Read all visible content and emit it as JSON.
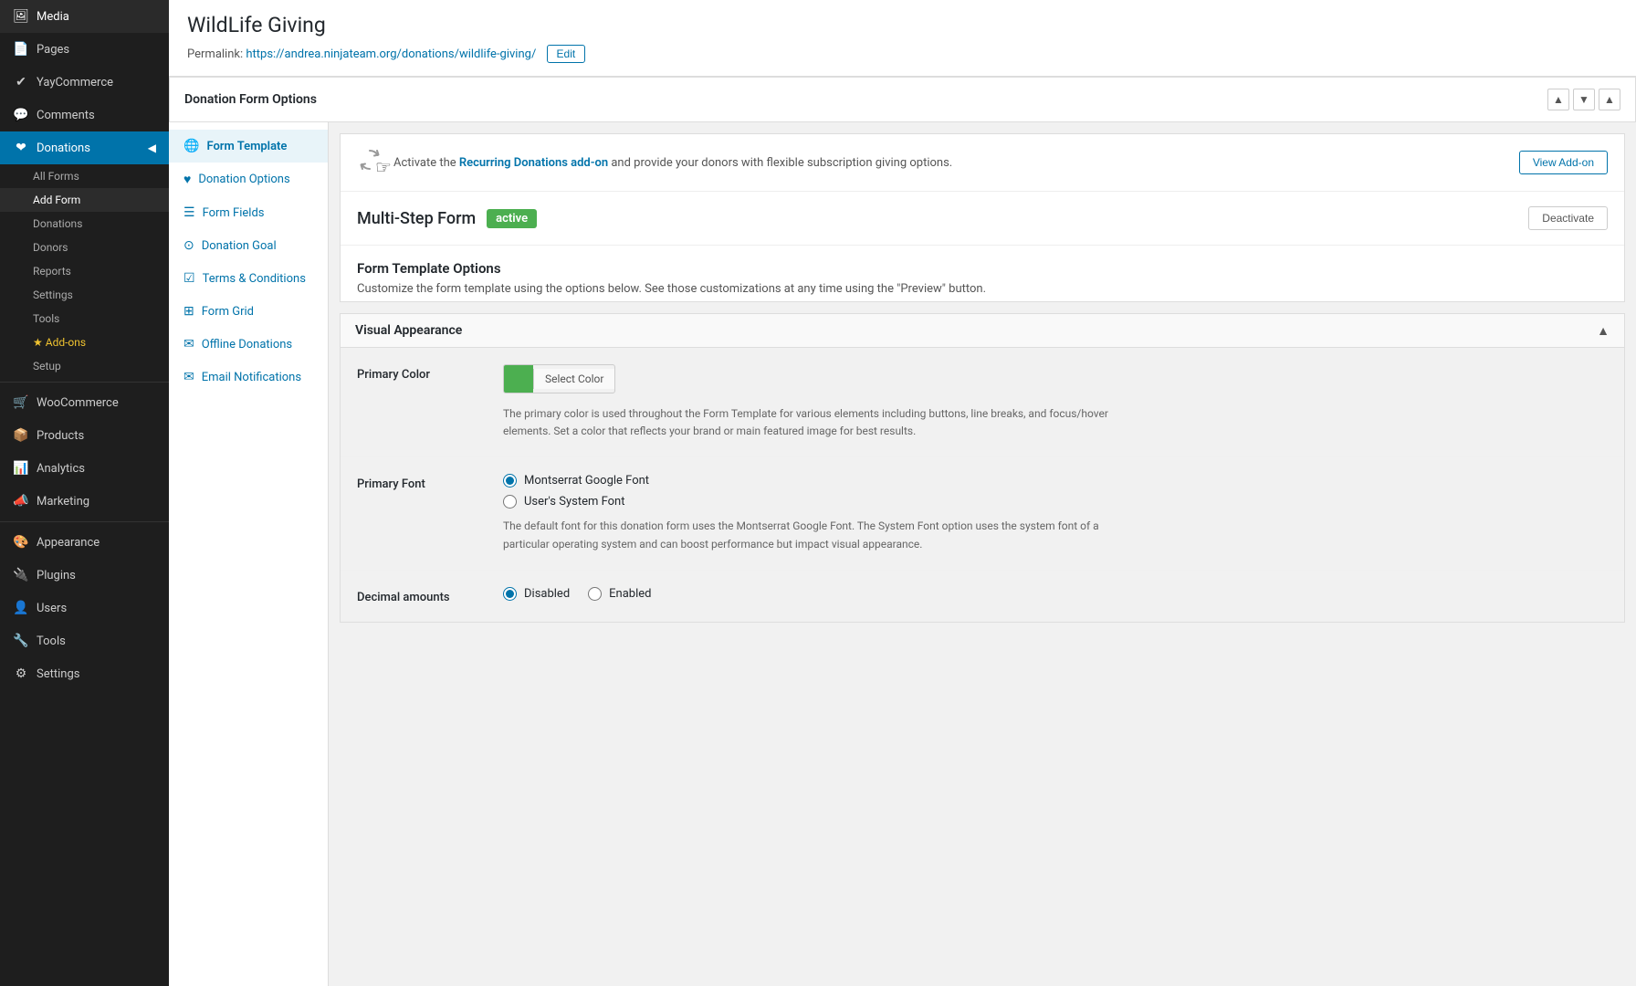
{
  "sidebar": {
    "items": [
      {
        "id": "media",
        "label": "Media",
        "icon": "🖼",
        "active": false
      },
      {
        "id": "pages",
        "label": "Pages",
        "icon": "📄",
        "active": false
      },
      {
        "id": "yaycommerce",
        "label": "YayCommerce",
        "icon": "✔",
        "active": false
      },
      {
        "id": "comments",
        "label": "Comments",
        "icon": "💬",
        "active": false
      },
      {
        "id": "donations",
        "label": "Donations",
        "icon": "❤",
        "active": true
      },
      {
        "id": "woocommerce",
        "label": "WooCommerce",
        "icon": "🛒",
        "active": false
      },
      {
        "id": "products",
        "label": "Products",
        "icon": "📦",
        "active": false
      },
      {
        "id": "analytics",
        "label": "Analytics",
        "icon": "📊",
        "active": false
      },
      {
        "id": "marketing",
        "label": "Marketing",
        "icon": "📣",
        "active": false
      },
      {
        "id": "appearance",
        "label": "Appearance",
        "icon": "🎨",
        "active": false
      },
      {
        "id": "plugins",
        "label": "Plugins",
        "icon": "🔌",
        "active": false
      },
      {
        "id": "users",
        "label": "Users",
        "icon": "👤",
        "active": false
      },
      {
        "id": "tools",
        "label": "Tools",
        "icon": "🔧",
        "active": false
      },
      {
        "id": "settings",
        "label": "Settings",
        "icon": "⚙",
        "active": false
      }
    ],
    "donations_subitems": [
      {
        "label": "All Forms",
        "active": false
      },
      {
        "label": "Add Form",
        "active": true
      },
      {
        "label": "Donations",
        "active": false
      },
      {
        "label": "Donors",
        "active": false
      },
      {
        "label": "Reports",
        "active": false
      },
      {
        "label": "Settings",
        "active": false
      },
      {
        "label": "Tools",
        "active": false
      },
      {
        "label": "Add-ons",
        "active": false
      },
      {
        "label": "Setup",
        "active": false
      }
    ]
  },
  "header": {
    "title": "WildLife Giving",
    "permalink_label": "Permalink:",
    "permalink_url": "https://andrea.ninjateam.org/donations/wildlife-giving/",
    "edit_label": "Edit"
  },
  "panel": {
    "title": "Donation Form Options",
    "ctrl_up": "▲",
    "ctrl_down": "▼",
    "ctrl_collapse": "▲"
  },
  "left_nav": {
    "items": [
      {
        "id": "form-template",
        "icon": "🌐",
        "label": "Form Template",
        "active": true
      },
      {
        "id": "donation-options",
        "icon": "♥",
        "label": "Donation Options",
        "active": false
      },
      {
        "id": "form-fields",
        "icon": "☰",
        "label": "Form Fields",
        "active": false
      },
      {
        "id": "donation-goal",
        "icon": "⊙",
        "label": "Donation Goal",
        "active": false
      },
      {
        "id": "terms-conditions",
        "icon": "☑",
        "label": "Terms & Conditions",
        "active": false
      },
      {
        "id": "form-grid",
        "icon": "⊞",
        "label": "Form Grid",
        "active": false
      },
      {
        "id": "offline-donations",
        "icon": "✉",
        "label": "Offline Donations",
        "active": false
      },
      {
        "id": "email-notifications",
        "icon": "✉",
        "label": "Email Notifications",
        "active": false
      }
    ]
  },
  "recurring_banner": {
    "text_before": "Activate the ",
    "link_text": "Recurring Donations add-on",
    "text_after": " and provide your donors with flexible subscription giving options.",
    "button_label": "View Add-on"
  },
  "multi_step": {
    "label": "Multi-Step Form",
    "badge": "active",
    "deactivate_label": "Deactivate"
  },
  "form_template_options": {
    "title": "Form Template Options",
    "description": "Customize the form template using the options below. See those customizations at any time using the \"Preview\" button."
  },
  "visual_appearance": {
    "title": "Visual Appearance",
    "collapse_icon": "▲",
    "primary_color": {
      "label": "Primary Color",
      "select_label": "Select Color",
      "color_hex": "#4caf50",
      "description": "The primary color is used throughout the Form Template for various elements including buttons, line breaks, and focus/hover elements. Set a color that reflects your brand or main featured image for best results."
    },
    "primary_font": {
      "label": "Primary Font",
      "options": [
        {
          "id": "montserrat",
          "label": "Montserrat Google Font",
          "selected": true
        },
        {
          "id": "system",
          "label": "User's System Font",
          "selected": false
        }
      ],
      "description": "The default font for this donation form uses the Montserrat Google Font. The System Font option uses the system font of a particular operating system and can boost performance but impact visual appearance."
    },
    "decimal_amounts": {
      "label": "Decimal amounts",
      "options": [
        {
          "id": "disabled",
          "label": "Disabled",
          "selected": true
        },
        {
          "id": "enabled",
          "label": "Enabled",
          "selected": false
        }
      ]
    }
  }
}
